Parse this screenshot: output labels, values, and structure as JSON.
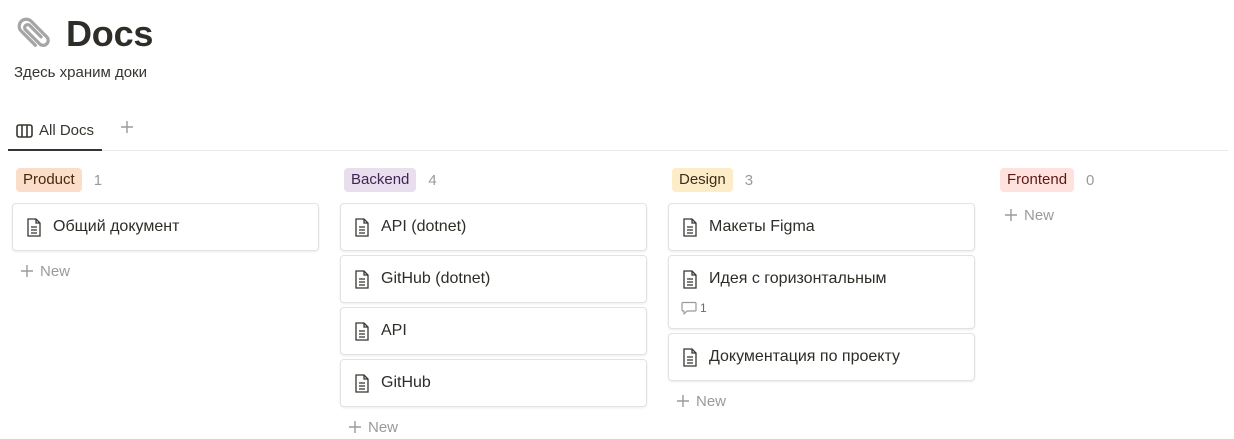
{
  "page": {
    "icon": "paperclip-icon",
    "title": "Docs",
    "description": "Здесь храним доки"
  },
  "views": {
    "active_tab": "All Docs",
    "tab_icon": "board-view-icon",
    "add_icon": "plus-icon"
  },
  "board": {
    "new_label": "New",
    "columns": [
      {
        "name": "Product",
        "count": "1",
        "badge_bg": "#fadec9",
        "badge_fg": "#49290e",
        "cards": [
          {
            "title": "Общий документ"
          }
        ]
      },
      {
        "name": "Backend",
        "count": "4",
        "badge_bg": "#e8deee",
        "badge_fg": "#412454",
        "cards": [
          {
            "title": "API (dotnet)"
          },
          {
            "title": "GitHub (dotnet)"
          },
          {
            "title": "API"
          },
          {
            "title": "GitHub"
          }
        ]
      },
      {
        "name": "Design",
        "count": "3",
        "badge_bg": "#fdecc8",
        "badge_fg": "#402c1b",
        "cards": [
          {
            "title": "Макеты Figma"
          },
          {
            "title": "Идея с горизонтальным",
            "comments": "1"
          },
          {
            "title": "Документация по проекту"
          }
        ]
      },
      {
        "name": "Frontend",
        "count": "0",
        "badge_bg": "#ffe2dd",
        "badge_fg": "#5d1715",
        "cards": []
      }
    ]
  }
}
